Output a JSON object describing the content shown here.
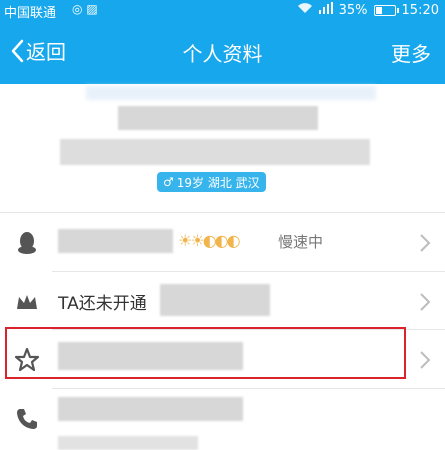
{
  "status_bar": {
    "carrier": "中国联通",
    "battery_percent": "35%",
    "battery_level": 0.35,
    "time": "15:20"
  },
  "navbar": {
    "back_label": "返回",
    "title": "个人资料",
    "more_label": "更多"
  },
  "profile": {
    "info_badge": "19岁 湖北 武汉"
  },
  "rows": {
    "qq_level": {
      "status": "慢速中"
    },
    "vip": {
      "label": "TA还未开通"
    }
  },
  "colors": {
    "brand_blue": "#16a7ec",
    "badge_blue": "#38b4ec",
    "highlight_red": "#d9242b"
  }
}
